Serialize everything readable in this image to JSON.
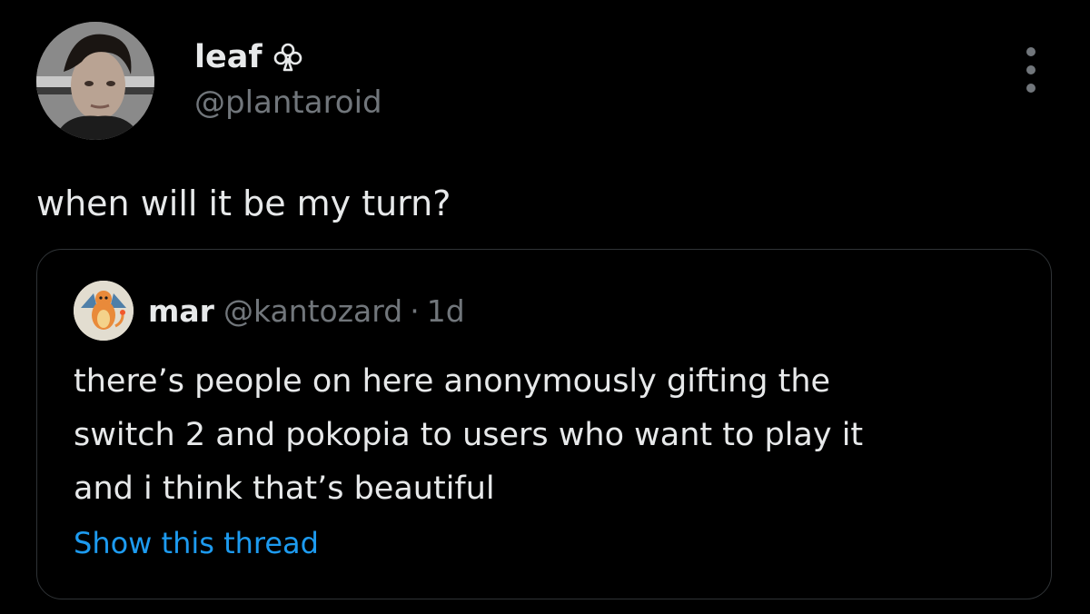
{
  "tweet": {
    "author": {
      "display_name": "leaf",
      "name_badge_icon": "club-outline-icon",
      "handle": "@plantaroid"
    },
    "text": "when will it be my turn?",
    "more_icon": "vertical-dots-icon"
  },
  "quoted_tweet": {
    "author": {
      "display_name": "mar",
      "handle": "@kantozard"
    },
    "separator": "·",
    "time": "1d",
    "text_lines": [
      "there’s people on here anonymously gifting the",
      "switch 2 and pokopia to users who want to play it",
      "and i think that’s beautiful"
    ],
    "show_thread_label": "Show this thread"
  },
  "colors": {
    "background": "#000000",
    "primary_text": "#e7e9ea",
    "secondary_text": "#71767b",
    "link": "#1d9bf0",
    "card_border": "#2f3336"
  }
}
